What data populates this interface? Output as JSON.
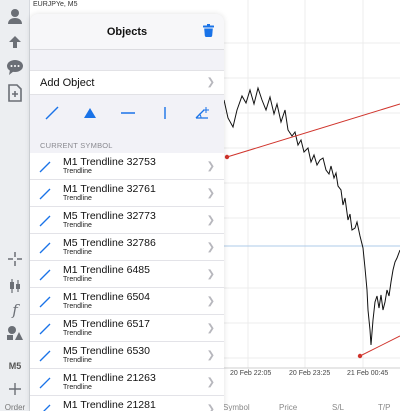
{
  "chart": {
    "symbol": "EURJPYe, M5",
    "time_labels": [
      "20 Feb 22:05",
      "20 Feb 23:25",
      "21 Feb 00:45"
    ]
  },
  "footer": {
    "order_label": "Order",
    "columns": [
      "Symbol",
      "Price",
      "S/L",
      "T/P"
    ]
  },
  "toolbar": {
    "timeframe": "M5"
  },
  "panel": {
    "title": "Objects",
    "add_object_label": "Add Object",
    "section_label": "CURRENT SYMBOL",
    "items": [
      {
        "name": "M1 Trendline 32753",
        "type": "Trendline"
      },
      {
        "name": "M1 Trendline 32761",
        "type": "Trendline"
      },
      {
        "name": "M5 Trendline 32773",
        "type": "Trendline"
      },
      {
        "name": "M5 Trendline 32786",
        "type": "Trendline"
      },
      {
        "name": "M1 Trendline 6485",
        "type": "Trendline"
      },
      {
        "name": "M1 Trendline 6504",
        "type": "Trendline"
      },
      {
        "name": "M5 Trendline 6517",
        "type": "Trendline"
      },
      {
        "name": "M5 Trendline 6530",
        "type": "Trendline"
      },
      {
        "name": "M1 Trendline 21263",
        "type": "Trendline"
      },
      {
        "name": "M1 Trendline 21281",
        "type": "Trendline"
      }
    ]
  },
  "colors": {
    "accent": "#1a73e8",
    "trendline": "#d0342c",
    "price_line": "#111111"
  }
}
